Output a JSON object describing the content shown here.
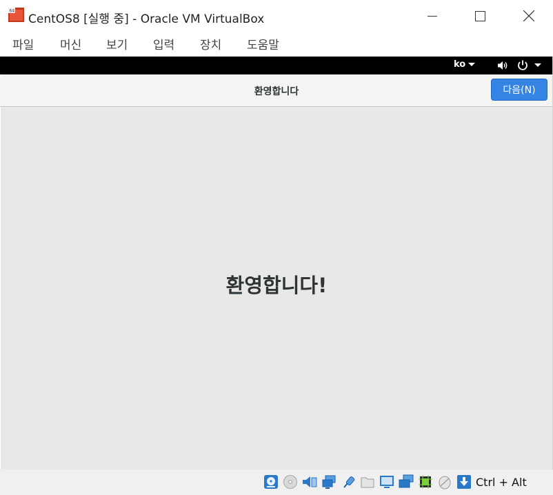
{
  "window": {
    "title": "CentOS8 [실행 중] - Oracle VM VirtualBox",
    "icon": "virtualbox-icon"
  },
  "menu": [
    "파일",
    "머신",
    "보기",
    "입력",
    "장치",
    "도움말"
  ],
  "topbar": {
    "language": "ko",
    "icons": [
      "volume-icon",
      "power-icon"
    ]
  },
  "header": {
    "title": "환영합니다",
    "next_label": "다음(N)"
  },
  "main": {
    "welcome": "환영합니다!"
  },
  "statusbar": {
    "icons": [
      "hard-disk-icon",
      "optical-drive-icon",
      "audio-icon",
      "network-icon",
      "usb-icon",
      "shared-folder-icon",
      "display-icon",
      "video-capture-icon",
      "cpu-icon",
      "mouse-integration-icon",
      "keyboard-capture-icon"
    ],
    "host_key": "Ctrl + Alt"
  },
  "colors": {
    "accent": "#3584e4",
    "content_bg": "#e8e8e7",
    "topbar_bg": "#000000"
  }
}
